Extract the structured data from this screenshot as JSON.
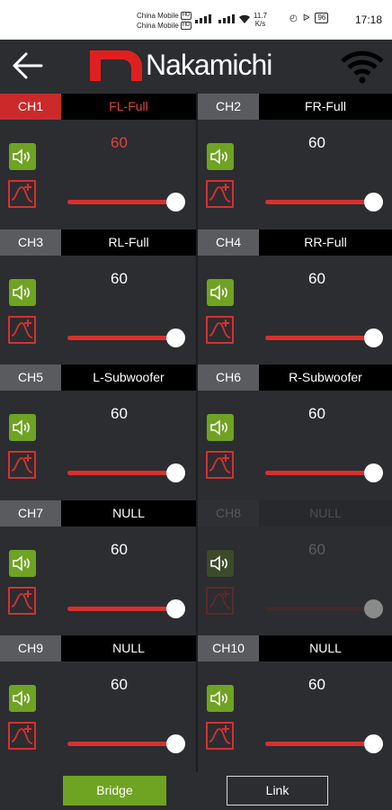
{
  "status_bar": {
    "carrier_1": "China Mobile",
    "carrier_2": "China Mobile",
    "carrier_badge": "HD",
    "net_speed": "11.7",
    "net_unit": "K/s",
    "battery": "96",
    "time": "17:18",
    "icons": [
      "sim-signal-icon",
      "wifi-icon",
      "alarm-icon",
      "bluetooth-icon",
      "battery-icon"
    ]
  },
  "header": {
    "brand": "Nakamichi",
    "brand_color": "#e02020",
    "icons": [
      "back-arrow-icon",
      "wifi-icon"
    ]
  },
  "channels": [
    {
      "ch": "CH1",
      "name": "FL-Full",
      "value": "60",
      "level": 1.0,
      "active": true,
      "enabled": true
    },
    {
      "ch": "CH2",
      "name": "FR-Full",
      "value": "60",
      "level": 1.0,
      "active": false,
      "enabled": true
    },
    {
      "ch": "CH3",
      "name": "RL-Full",
      "value": "60",
      "level": 1.0,
      "active": false,
      "enabled": true
    },
    {
      "ch": "CH4",
      "name": "RR-Full",
      "value": "60",
      "level": 1.0,
      "active": false,
      "enabled": true
    },
    {
      "ch": "CH5",
      "name": "L-Subwoofer",
      "value": "60",
      "level": 1.0,
      "active": false,
      "enabled": true
    },
    {
      "ch": "CH6",
      "name": "R-Subwoofer",
      "value": "60",
      "level": 1.0,
      "active": false,
      "enabled": true
    },
    {
      "ch": "CH7",
      "name": "NULL",
      "value": "60",
      "level": 1.0,
      "active": false,
      "enabled": true
    },
    {
      "ch": "CH8",
      "name": "NULL",
      "value": "60",
      "level": 1.0,
      "active": false,
      "enabled": false
    },
    {
      "ch": "CH9",
      "name": "NULL",
      "value": "60",
      "level": 1.0,
      "active": false,
      "enabled": true
    },
    {
      "ch": "CH10",
      "name": "NULL",
      "value": "60",
      "level": 1.0,
      "active": false,
      "enabled": true
    }
  ],
  "footer": {
    "bridge_label": "Bridge",
    "link_label": "Link"
  },
  "colors": {
    "background": "#2b2d31",
    "accent_red": "#d6312f",
    "accent_green": "#6fa322",
    "channel_tab": "#595b5f"
  }
}
